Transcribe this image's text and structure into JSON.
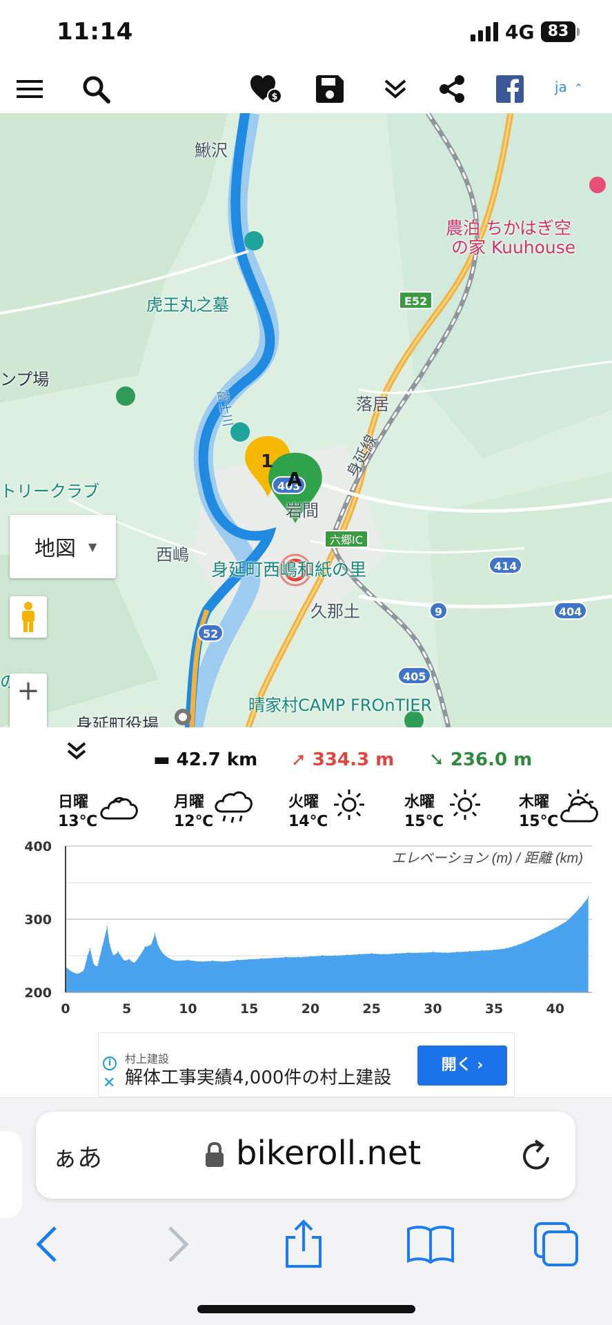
{
  "status_bar": {
    "time": "11:14",
    "network": "4G",
    "battery": "83"
  },
  "toolbar": {
    "language": "ja"
  },
  "map": {
    "map_type_label": "地図",
    "zoom_in_label": "+",
    "labels": {
      "ayusawa": "鰍沢",
      "noudomari": "農泊 ちかはぎ空",
      "noudomari2": "の家 Kuuhouse",
      "toraomaru": "虎王丸之墓",
      "camp_left": "ンプ場",
      "ochii": "落居",
      "minobu_line": "身延線",
      "country_club": "トリークラブ",
      "kishima": "西嶋",
      "iwama": "岩間",
      "washi": "身延町西嶋和紙の里",
      "kunado": "久那土",
      "rokugo_ic": "六郷IC",
      "left_sato": "の里",
      "camp_frontier": "晴家村CAMP FROnTIER",
      "town_office": "身延町役場",
      "river": "富士川"
    },
    "shields": {
      "e52": "E52",
      "r403": "403",
      "r414": "414",
      "r9": "9",
      "r404": "404",
      "r52": "52",
      "r405": "405"
    },
    "markers": {
      "waypoint": "1",
      "start": "A"
    }
  },
  "stats": {
    "distance": "42.7 km",
    "ascent": "334.3 m",
    "descent": "236.0 m"
  },
  "weather": [
    {
      "day": "日曜",
      "temp": "13℃",
      "icon": "cloudy-icon"
    },
    {
      "day": "月曜",
      "temp": "12℃",
      "icon": "rain-icon"
    },
    {
      "day": "火曜",
      "temp": "14℃",
      "icon": "sunny-icon"
    },
    {
      "day": "水曜",
      "temp": "15℃",
      "icon": "sunny-icon"
    },
    {
      "day": "木曜",
      "temp": "15℃",
      "icon": "partly-cloudy-icon"
    }
  ],
  "chart_data": {
    "type": "area",
    "title": "エレベーション (m) / 距離 (km)",
    "xlabel": "",
    "ylabel": "",
    "xlim": [
      0,
      43
    ],
    "ylim": [
      200,
      400
    ],
    "x_ticks": [
      "0",
      "5",
      "10",
      "15",
      "20",
      "25",
      "30",
      "35",
      "40"
    ],
    "y_ticks": [
      "200",
      "300",
      "400"
    ],
    "grid": true,
    "series": [
      {
        "x": [
          0,
          0.5,
          1,
          1.5,
          1.8,
          2,
          2.3,
          2.6,
          3,
          3.4,
          3.6,
          3.9,
          4.3,
          4.8,
          5.2,
          5.6,
          6,
          6.5,
          7,
          7.3,
          7.6,
          8,
          8.5,
          9,
          10,
          11,
          12,
          13,
          14,
          15,
          16,
          17,
          18,
          19,
          20,
          21,
          22,
          23,
          24,
          25,
          26,
          27,
          28,
          29,
          30,
          31,
          32,
          33,
          34,
          35,
          36,
          37,
          38,
          39,
          40,
          41,
          42,
          42.7
        ],
        "y": [
          235,
          228,
          225,
          230,
          250,
          260,
          238,
          235,
          262,
          290,
          265,
          250,
          255,
          243,
          245,
          240,
          248,
          262,
          265,
          280,
          262,
          252,
          246,
          243,
          244,
          242,
          243,
          242,
          244,
          245,
          246,
          247,
          248,
          248,
          249,
          250,
          250,
          251,
          252,
          253,
          252,
          253,
          254,
          254,
          255,
          254,
          255,
          256,
          257,
          258,
          260,
          265,
          272,
          280,
          288,
          298,
          315,
          330
        ]
      }
    ]
  },
  "ad": {
    "sponsor": "村上建設",
    "headline": "解体工事実績4,000件の村上建設",
    "cta": "開く ›"
  },
  "safari": {
    "reader_label": "ぁあ",
    "host": "bikeroll.net"
  }
}
